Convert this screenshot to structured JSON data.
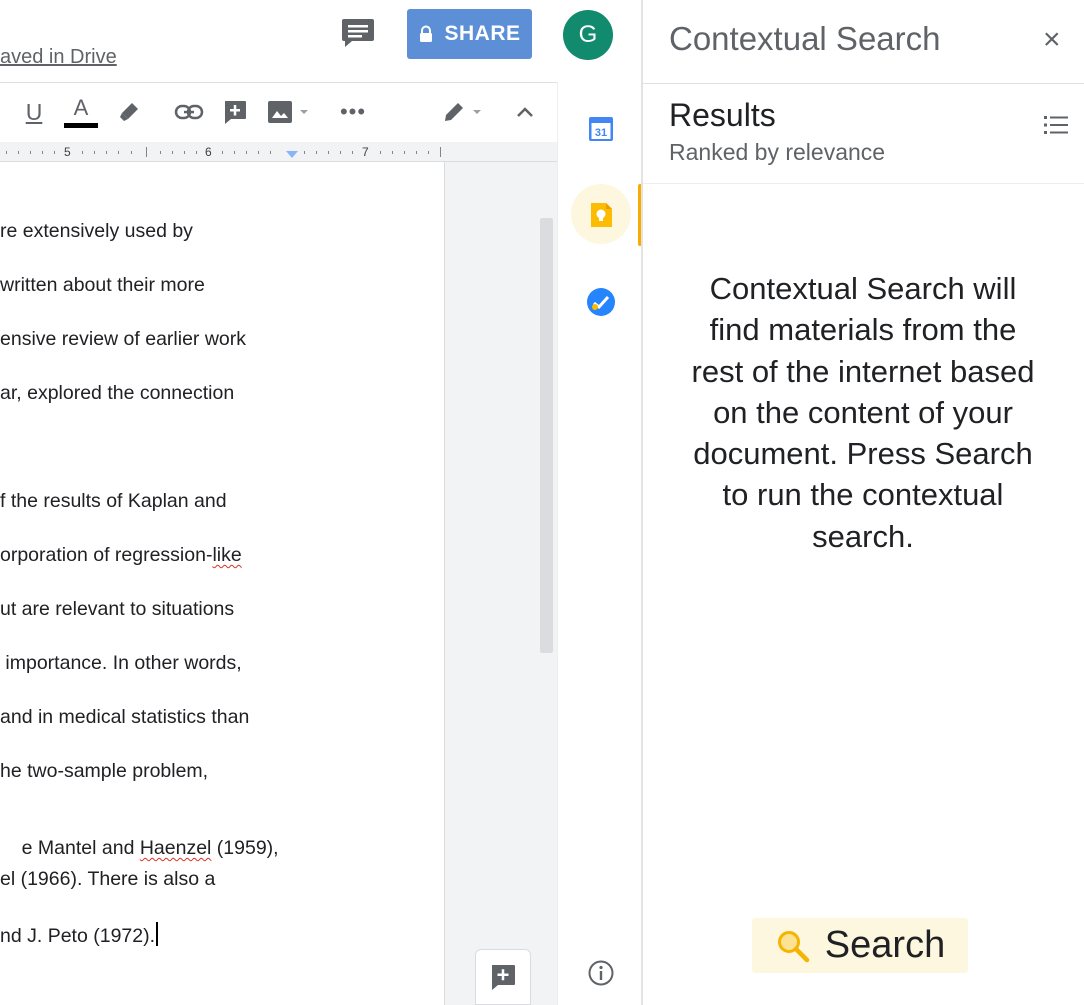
{
  "header": {
    "saved_status": "aved in Drive",
    "share_label": "SHARE",
    "avatar_letter": "G"
  },
  "ruler": {
    "mark_5": "5",
    "mark_6": "6",
    "mark_7": "7"
  },
  "document": {
    "lines": [
      "re extensively used by",
      "written about their more",
      "ensive review of earlier work",
      "ar, explored the connection",
      "f the results of Kaplan and",
      "orporation of regression-",
      "like",
      "ut are relevant to situations",
      " importance. In other words,",
      "and in medical statistics than",
      "he two-sample problem,",
      "e Mantel and ",
      "Haenzel",
      " (1959),",
      "el (1966). There is also a",
      "nd J. Peto (1972)."
    ]
  },
  "rail": {
    "calendar_day": "31"
  },
  "panel": {
    "title": "Contextual Search",
    "close_symbol": "×",
    "results_title": "Results",
    "results_subtitle": "Ranked by relevance",
    "message": "Contextual Search will find materials from the rest of the internet based on the content of your document. Press Search to run the contextual search.",
    "search_label": "Search"
  },
  "colors": {
    "share_button": "#5c8fd6",
    "avatar": "#118a6e",
    "keep_accent": "#f9ab00",
    "search_button_bg": "#fef7e0"
  }
}
